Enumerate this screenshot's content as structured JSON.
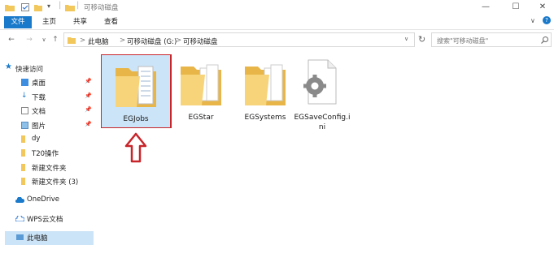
{
  "window": {
    "title": "可移动磁盘",
    "minimize_glyph": "—",
    "maximize_glyph": "☐",
    "close_glyph": "✕"
  },
  "ribbon": {
    "tabs": [
      "文件",
      "主页",
      "共享",
      "查看"
    ],
    "help_glyph": "?",
    "expand_glyph": "∨"
  },
  "address": {
    "crumbs": [
      "此电脑",
      "可移动磁盘 (G:)",
      "可移动磁盘"
    ],
    "separator": ">"
  },
  "search": {
    "placeholder": "搜索\"可移动磁盘\""
  },
  "sidebar": {
    "quick_access": "快速访问",
    "items": [
      {
        "label": "桌面",
        "pinned": true
      },
      {
        "label": "下载",
        "pinned": true
      },
      {
        "label": "文档",
        "pinned": true
      },
      {
        "label": "图片",
        "pinned": true
      },
      {
        "label": "dy",
        "pinned": false
      },
      {
        "label": "T20操作",
        "pinned": false
      },
      {
        "label": "新建文件夹",
        "pinned": false
      },
      {
        "label": "新建文件夹 (3)",
        "pinned": false
      }
    ],
    "onedrive": "OneDrive",
    "wps": "WPS云文档",
    "this_pc": "此电脑"
  },
  "files": [
    {
      "name": "EGJobs",
      "type": "folder",
      "selected": true
    },
    {
      "name": "EGStar",
      "type": "folder",
      "selected": false
    },
    {
      "name": "EGSystems",
      "type": "folder",
      "selected": false
    },
    {
      "name": "EGSaveConfig.ini",
      "type": "config-file",
      "selected": false
    }
  ],
  "colors": {
    "accent": "#1979ca",
    "selection": "#cce4f7",
    "highlight_box": "#c8252a",
    "folder": "#f2c75c"
  }
}
